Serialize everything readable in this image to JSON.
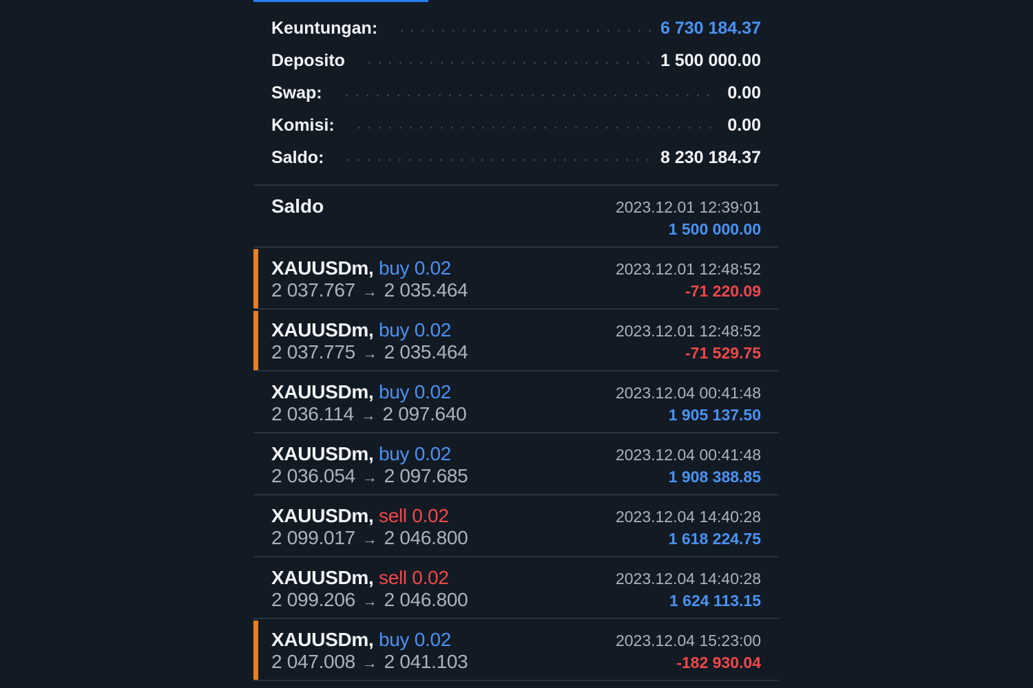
{
  "summary": {
    "profit": {
      "label": "Keuntungan:",
      "value": "6 730 184.37"
    },
    "deposit": {
      "label": "Deposito",
      "value": "1 500 000.00"
    },
    "swap": {
      "label": "Swap:",
      "value": "0.00"
    },
    "commission": {
      "label": "Komisi:",
      "value": "0.00"
    },
    "balance": {
      "label": "Saldo:",
      "value": "8 230 184.37"
    }
  },
  "deposit_entry": {
    "title": "Saldo",
    "time": "2023.12.01 12:39:01",
    "amount": "1 500 000.00"
  },
  "trades": [
    {
      "symbol": "XAUUSDm,",
      "side": "buy 0.02",
      "open": "2 037.767",
      "close": "2 035.464",
      "time": "2023.12.01 12:48:52",
      "profit": "-71 220.09"
    },
    {
      "symbol": "XAUUSDm,",
      "side": "buy 0.02",
      "open": "2 037.775",
      "close": "2 035.464",
      "time": "2023.12.01 12:48:52",
      "profit": "-71 529.75"
    },
    {
      "symbol": "XAUUSDm,",
      "side": "buy 0.02",
      "open": "2 036.114",
      "close": "2 097.640",
      "time": "2023.12.04 00:41:48",
      "profit": "1 905 137.50"
    },
    {
      "symbol": "XAUUSDm,",
      "side": "buy 0.02",
      "open": "2 036.054",
      "close": "2 097.685",
      "time": "2023.12.04 00:41:48",
      "profit": "1 908 388.85"
    },
    {
      "symbol": "XAUUSDm,",
      "side": "sell 0.02",
      "open": "2 099.017",
      "close": "2 046.800",
      "time": "2023.12.04 14:40:28",
      "profit": "1 618 224.75"
    },
    {
      "symbol": "XAUUSDm,",
      "side": "sell 0.02",
      "open": "2 099.206",
      "close": "2 046.800",
      "time": "2023.12.04 14:40:28",
      "profit": "1 624 113.15"
    },
    {
      "symbol": "XAUUSDm,",
      "side": "buy 0.02",
      "open": "2 047.008",
      "close": "2 041.103",
      "time": "2023.12.04 15:23:00",
      "profit": "-182 930.04"
    }
  ],
  "arrow_glyph": "→",
  "colors": {
    "background": "#121a24",
    "accent_blue": "#4a93f2",
    "loss_red": "#f04848",
    "loss_marker_orange": "#f07d1a"
  }
}
